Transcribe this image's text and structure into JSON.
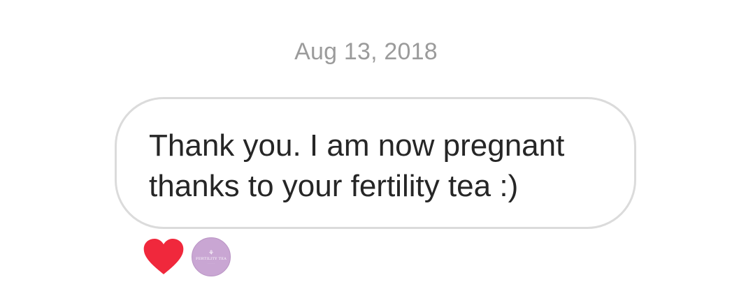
{
  "conversation": {
    "date_label": "Aug 13, 2018"
  },
  "message": {
    "text": "Thank you. I am now pregnant\nthanks to your fertility tea :)"
  },
  "reactions": [
    {
      "type": "heart",
      "icon": "heart-icon",
      "color": "#f0283c"
    },
    {
      "type": "avatar",
      "icon": "fertility-tea-logo",
      "color": "#c9a6d3",
      "logo_text": "FERTILITY TEA"
    }
  ]
}
